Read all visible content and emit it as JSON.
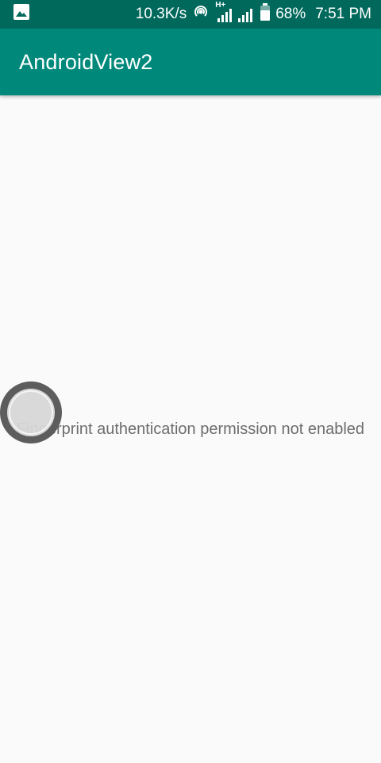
{
  "status_bar": {
    "net_speed": "10.3K/s",
    "network_type": "H+",
    "battery": "68%",
    "time": "7:51 PM",
    "icons": [
      "image-icon",
      "hotspot-icon",
      "signal-icon",
      "signal-icon",
      "battery-icon"
    ]
  },
  "app_bar": {
    "title": "AndroidView2",
    "color": "#00897b"
  },
  "main": {
    "message": "Fingerprint authentication permission not enabled"
  },
  "colors": {
    "status_bar": "#00695c",
    "app_bar": "#00897b",
    "background": "#fafafa",
    "message_text": "#6d6d6d"
  }
}
